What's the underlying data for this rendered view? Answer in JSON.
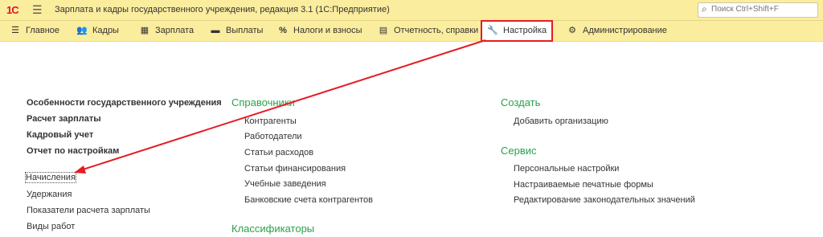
{
  "window": {
    "logo": "1С",
    "title": "Зарплата и кадры государственного учреждения, редакция 3.1  (1С:Предприятие)",
    "search_placeholder": "Поиск Ctrl+Shift+F"
  },
  "nav": [
    {
      "label": "Главное",
      "icon": "menu-icon"
    },
    {
      "label": "Кадры",
      "icon": "people-icon"
    },
    {
      "label": "Зарплата",
      "icon": "calculator-icon"
    },
    {
      "label": "Выплаты",
      "icon": "wallet-icon"
    },
    {
      "label": "Налоги и взносы",
      "icon": "percent-icon"
    },
    {
      "label": "Отчетность, справки",
      "icon": "report-icon"
    },
    {
      "label": "Настройка",
      "icon": "wrench-icon",
      "active": true
    },
    {
      "label": "Администрирование",
      "icon": "gear-icon"
    }
  ],
  "left": {
    "bold": [
      "Особенности государственного учреждения",
      "Расчет зарплаты",
      "Кадровый учет",
      "Отчет по настройкам"
    ],
    "links": [
      "Начисления",
      "Удержания",
      "Показатели расчета зарплаты",
      "Виды работ"
    ]
  },
  "middle": {
    "header": "Справочники",
    "links": [
      "Контрагенты",
      "Работодатели",
      "Статьи расходов",
      "Статьи финансирования",
      "Учебные заведения",
      "Банковские счета контрагентов"
    ],
    "header2": "Классификаторы"
  },
  "right": {
    "create_header": "Создать",
    "create_links": [
      "Добавить организацию"
    ],
    "service_header": "Сервис",
    "service_links": [
      "Персональные настройки",
      "Настраиваемые печатные формы",
      "Редактирование законодательных значений"
    ]
  },
  "colors": {
    "accent_bar": "#fbed9e",
    "highlight": "#e51c23",
    "section_header": "#2aa14a"
  }
}
